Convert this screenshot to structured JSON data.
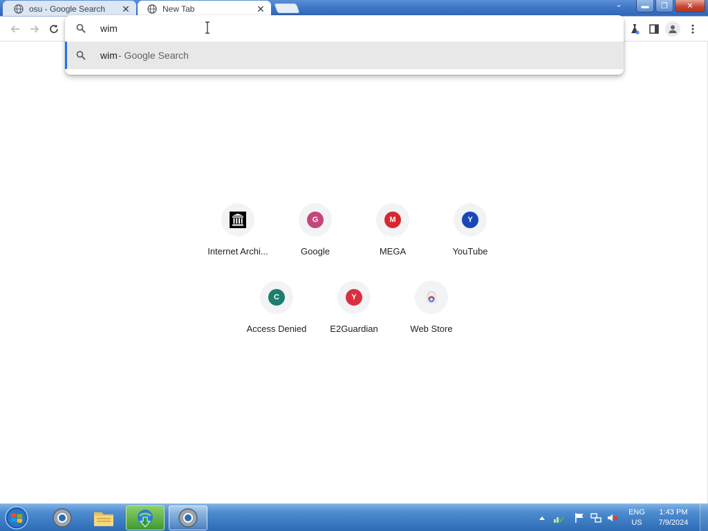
{
  "browser": {
    "tabs": [
      {
        "title": "osu - Google Search",
        "close": "✕",
        "active": false
      },
      {
        "title": "New Tab",
        "close": "✕",
        "active": true
      }
    ],
    "window_controls": {
      "minimize": "▬",
      "maximize": "❐",
      "close": "✕",
      "dropdown": "⌄"
    },
    "omnibox": {
      "value": "wim",
      "suggestion": {
        "query": "wim",
        "separator": "- Google Search"
      }
    }
  },
  "shortcuts": [
    {
      "label": "Internet Archi...",
      "icon": "archive-icon"
    },
    {
      "label": "Google",
      "letter": "G",
      "color": "#c2477a"
    },
    {
      "label": "MEGA",
      "letter": "M",
      "color": "#d9272e"
    },
    {
      "label": "YouTube",
      "letter": "Y",
      "color": "#1a47b8"
    },
    {
      "label": "Access Denied",
      "letter": "C",
      "color": "#1d7d6f"
    },
    {
      "label": "E2Guardian",
      "letter": "Y",
      "color": "#d93040"
    },
    {
      "label": "Web Store",
      "icon": "webstore-icon"
    }
  ],
  "taskbar": {
    "language": {
      "line1": "ENG",
      "line2": "US"
    },
    "clock": {
      "time": "1:43 PM",
      "date": "7/9/2024"
    }
  },
  "colors": {
    "omnibox_highlight": "#1a73e8",
    "suggestion_bg": "#e8e8e8",
    "tile_bg": "#f1f3f4"
  }
}
